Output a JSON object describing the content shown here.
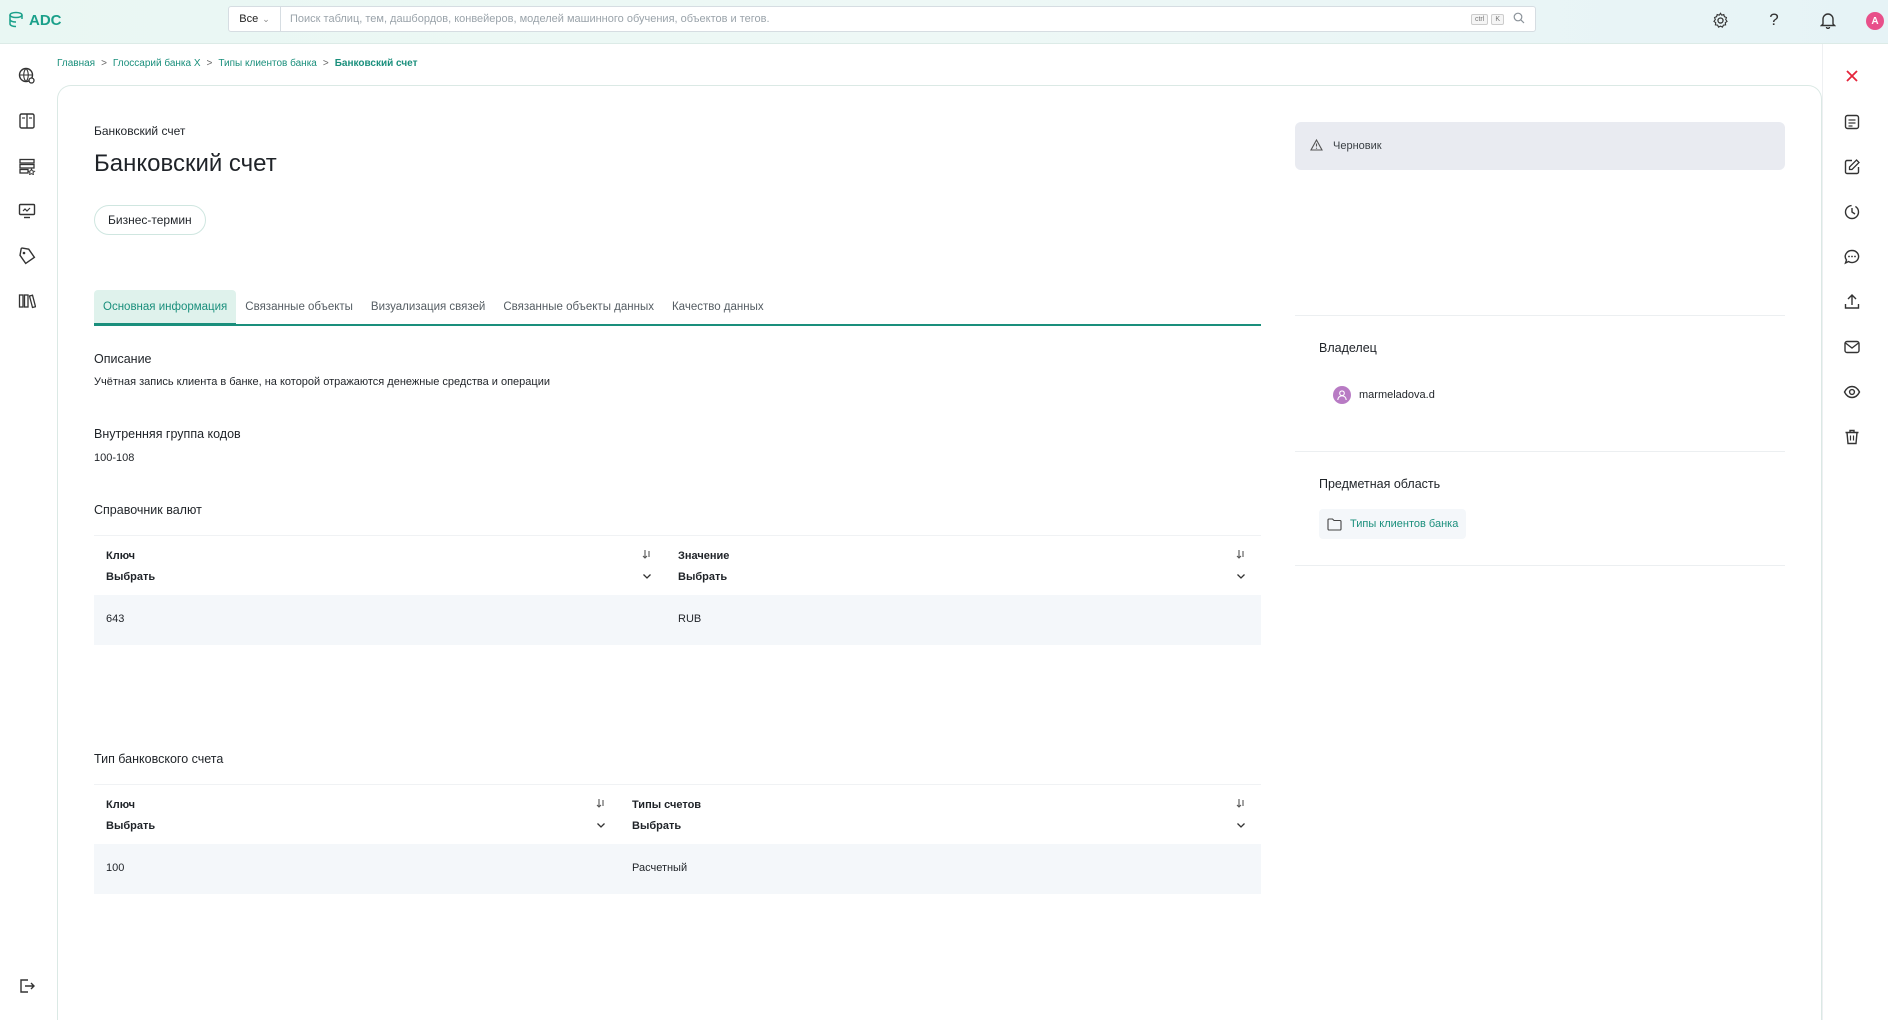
{
  "app": {
    "logo_text": "ADC",
    "user_initial": "A"
  },
  "search": {
    "scope": "Все",
    "placeholder": "Поиск таблиц, тем, дашбордов, конвейеров, моделей машинного обучения, объектов и тегов.",
    "shortcut_ctrl": "ctrl",
    "shortcut_key": "K"
  },
  "breadcrumb": {
    "items": [
      "Главная",
      "Глоссарий банка X",
      "Типы клиентов банка"
    ],
    "current": "Банковский счет",
    "separator": ">"
  },
  "entity": {
    "subtitle": "Банковский счет",
    "title": "Банковский счет",
    "type_tag": "Бизнес-термин"
  },
  "tabs": [
    {
      "label": "Основная информация",
      "active": true
    },
    {
      "label": "Связанные объекты"
    },
    {
      "label": "Визуализация связей"
    },
    {
      "label": "Связанные объекты данных"
    },
    {
      "label": "Качество данных"
    }
  ],
  "description": {
    "label": "Описание",
    "text": "Учётная запись клиента в банке, на которой отражаются денежные средства и операции"
  },
  "code_group": {
    "label": "Внутренняя группа кодов",
    "value": "100-108"
  },
  "currency_table": {
    "label": "Справочник валют",
    "columns": [
      {
        "title": "Ключ",
        "filter": "Выбрать"
      },
      {
        "title": "Значение",
        "filter": "Выбрать"
      }
    ],
    "rows": [
      [
        "643",
        "RUB"
      ]
    ]
  },
  "account_type_table": {
    "label": "Тип банковского счета",
    "columns": [
      {
        "title": "Ключ",
        "filter": "Выбрать"
      },
      {
        "title": "Типы счетов",
        "filter": "Выбрать"
      }
    ],
    "rows": [
      [
        "100",
        "Расчетный"
      ]
    ]
  },
  "sidebar_right": {
    "status": "Черновик",
    "owner_label": "Владелец",
    "owner_name": "marmeladova.d",
    "domain_label": "Предметная область",
    "domain_value": "Типы клиентов банка"
  },
  "colors": {
    "accent": "#1a8f7c",
    "close": "#e5243b",
    "status_bg": "#e9ebf1",
    "row_bg": "#f4f7fa"
  }
}
